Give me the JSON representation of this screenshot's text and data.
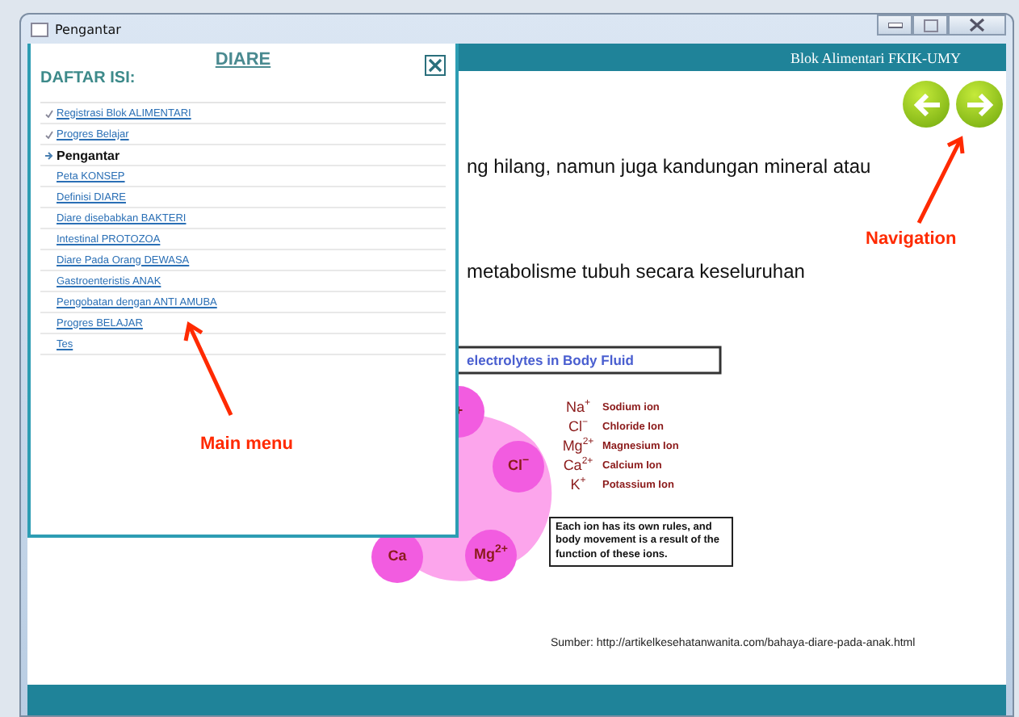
{
  "window": {
    "title": "Pengantar"
  },
  "header": {
    "title": "Blok Alimentari FKIK-UMY"
  },
  "navigation": [
    {
      "kind": "back"
    },
    {
      "kind": "forward"
    }
  ],
  "content": {
    "paragraphs": [
      "ng hilang, namun juga kandungan mineral atau",
      "metabolisme tubuh secara keseluruhan"
    ],
    "diagram": {
      "title": "electrolytes in Body Fluid",
      "ions": [
        {
          "label": "+"
        },
        {
          "label": "Cl$^{−}$"
        },
        {
          "label": "Ca"
        },
        {
          "label": "Mg$^{2+}$"
        }
      ],
      "legend": [
        {
          "symbol": "Na$^{+}$",
          "name": "Sodium ion"
        },
        {
          "symbol": "Cl$^{−}$",
          "name": "Chloride Ion"
        },
        {
          "symbol": "Mg$^{2+}$",
          "name": "Magnesium Ion"
        },
        {
          "symbol": "Ca$^{2+}$",
          "name": "Calcium Ion"
        },
        {
          "symbol": "K$^{+}$",
          "name": "Potassium Ion"
        }
      ],
      "note": "Each ion has its own rules, and body movement is a result of the function of these ions."
    },
    "source": "Sumber: http://artikelkesehatanwanita.com/bahaya-diare-pada-anak.html"
  },
  "menu": {
    "title": "DIARE",
    "heading": "DAFTAR ISI:",
    "items": [
      {
        "label": "Registrasi Blok ALIMENTARI",
        "checked": true,
        "selected": false
      },
      {
        "label": "Progres Belajar",
        "checked": true,
        "selected": false
      },
      {
        "label": "Pengantar",
        "checked": false,
        "selected": true
      },
      {
        "label": "Peta KONSEP",
        "checked": false,
        "selected": false
      },
      {
        "label": "Definisi DIARE",
        "checked": false,
        "selected": false
      },
      {
        "label": "Diare disebabkan BAKTERI",
        "checked": false,
        "selected": false
      },
      {
        "label": "Intestinal PROTOZOA",
        "checked": false,
        "selected": false
      },
      {
        "label": "Diare Pada Orang DEWASA",
        "checked": false,
        "selected": false
      },
      {
        "label": "Gastroenteristis ANAK",
        "checked": false,
        "selected": false
      },
      {
        "label": "Pengobatan dengan ANTI AMUBA",
        "checked": false,
        "selected": false
      },
      {
        "label": "Progres BELAJAR",
        "checked": false,
        "selected": false
      },
      {
        "label": "Tes",
        "checked": false,
        "selected": false
      }
    ]
  },
  "annotations": [
    {
      "label": "Navigation"
    },
    {
      "label": "Main menu"
    }
  ]
}
